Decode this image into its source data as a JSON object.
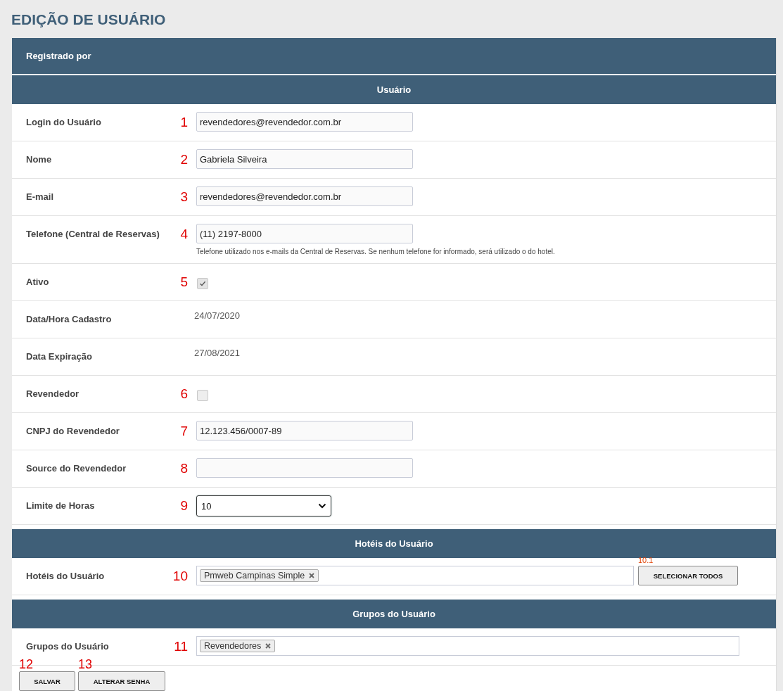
{
  "page_title": "EDIÇÃO DE USUÁRIO",
  "registered_by": {
    "label": "Registrado por"
  },
  "sections": [
    {
      "title": "Usuário",
      "rows": [
        {
          "kind": "text",
          "label": "Login do Usuário",
          "marker": "1",
          "value": "revendedores@revendedor.com.br"
        },
        {
          "kind": "text",
          "label": "Nome",
          "marker": "2",
          "value": "Gabriela Silveira"
        },
        {
          "kind": "text",
          "label": "E-mail",
          "marker": "3",
          "value": "revendedores@revendedor.com.br"
        },
        {
          "kind": "text",
          "label": "Telefone (Central de Reservas)",
          "marker": "4",
          "value": "(11) 2197-8000",
          "hint": "Telefone utilizado nos e-mails da Central de Reservas. Se nenhum telefone for informado, será utilizado o do hotel."
        },
        {
          "kind": "checkbox",
          "label": "Ativo",
          "marker": "5",
          "checked": true
        },
        {
          "kind": "static",
          "label": "Data/Hora Cadastro",
          "value": "24/07/2020"
        },
        {
          "kind": "static",
          "label": "Data Expiração",
          "value": "27/08/2021"
        },
        {
          "kind": "checkbox",
          "label": "Revendedor",
          "marker": "6",
          "checked": false
        },
        {
          "kind": "text",
          "label": "CNPJ do Revendedor",
          "marker": "7",
          "value": "12.123.456/0007-89"
        },
        {
          "kind": "text",
          "label": "Source do Revendedor",
          "marker": "8",
          "value": ""
        },
        {
          "kind": "select",
          "label": "Limite de Horas",
          "marker": "9",
          "value": "10"
        }
      ]
    },
    {
      "title": "Hotéis do Usuário",
      "rows": [
        {
          "kind": "tags",
          "label": "Hotéis do Usuário",
          "marker": "10",
          "tags": [
            "Pmweb Campinas Simple"
          ],
          "button": {
            "label": "SELECIONAR TODOS",
            "marker": "10.1"
          }
        }
      ]
    },
    {
      "title": "Grupos do Usuário",
      "rows": [
        {
          "kind": "tags",
          "label": "Grupos do Usuário",
          "marker": "11",
          "tags": [
            "Revendedores"
          ]
        }
      ]
    }
  ],
  "buttons": [
    {
      "label": "SALVAR",
      "marker": "12"
    },
    {
      "label": "ALTERAR SENHA",
      "marker": "13"
    }
  ]
}
